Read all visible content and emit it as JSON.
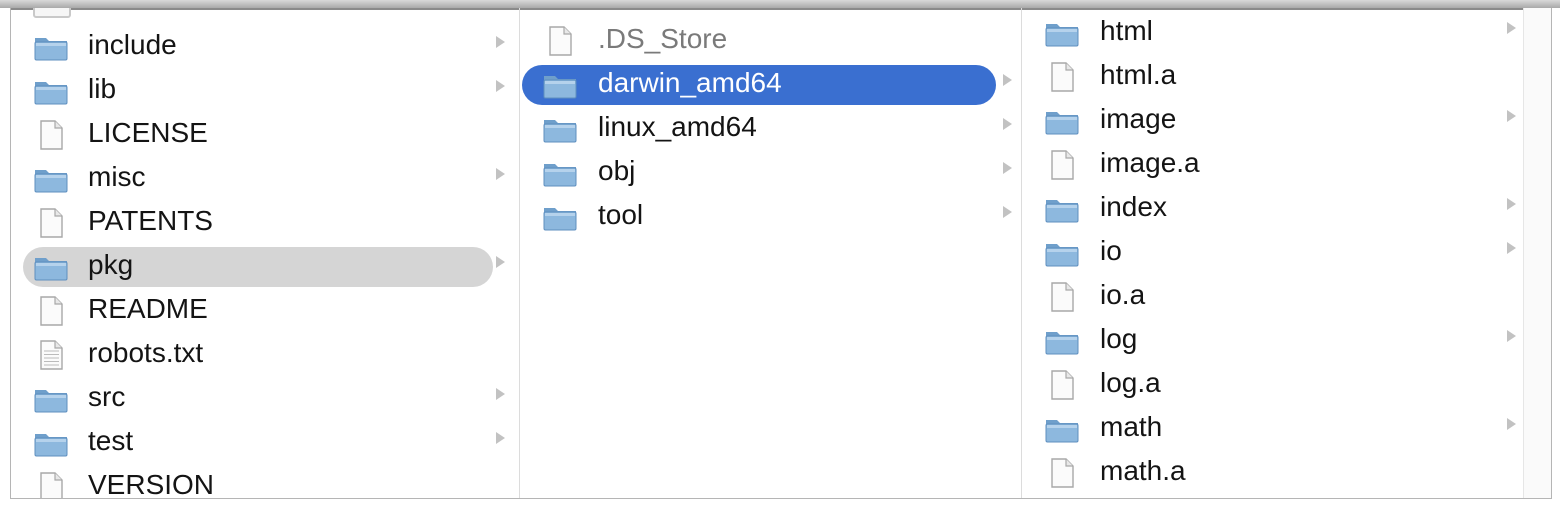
{
  "colors": {
    "selection_active": "#3a6fd0",
    "selection_inactive": "#d5d5d5",
    "folder": "#8db8de",
    "text": "#141414"
  },
  "columns": [
    {
      "items": [
        {
          "name": "include",
          "kind": "folder",
          "arrow": true
        },
        {
          "name": "lib",
          "kind": "folder",
          "arrow": true
        },
        {
          "name": "LICENSE",
          "kind": "file",
          "arrow": false
        },
        {
          "name": "misc",
          "kind": "folder",
          "arrow": true
        },
        {
          "name": "PATENTS",
          "kind": "file",
          "arrow": false
        },
        {
          "name": "pkg",
          "kind": "folder",
          "arrow": true,
          "selected": "inactive"
        },
        {
          "name": "README",
          "kind": "file",
          "arrow": false
        },
        {
          "name": "robots.txt",
          "kind": "text-file",
          "arrow": false
        },
        {
          "name": "src",
          "kind": "folder",
          "arrow": true
        },
        {
          "name": "test",
          "kind": "folder",
          "arrow": true
        },
        {
          "name": "VERSION",
          "kind": "file",
          "arrow": false
        }
      ]
    },
    {
      "items": [
        {
          "name": ".DS_Store",
          "kind": "file",
          "arrow": false,
          "dim": true
        },
        {
          "name": "darwin_amd64",
          "kind": "folder",
          "arrow": true,
          "selected": "active"
        },
        {
          "name": "linux_amd64",
          "kind": "folder",
          "arrow": true
        },
        {
          "name": "obj",
          "kind": "folder",
          "arrow": true
        },
        {
          "name": "tool",
          "kind": "folder",
          "arrow": true
        }
      ]
    },
    {
      "items": [
        {
          "name": "html",
          "kind": "folder",
          "arrow": true
        },
        {
          "name": "html.a",
          "kind": "file",
          "arrow": false
        },
        {
          "name": "image",
          "kind": "folder",
          "arrow": true
        },
        {
          "name": "image.a",
          "kind": "file",
          "arrow": false
        },
        {
          "name": "index",
          "kind": "folder",
          "arrow": true
        },
        {
          "name": "io",
          "kind": "folder",
          "arrow": true
        },
        {
          "name": "io.a",
          "kind": "file",
          "arrow": false
        },
        {
          "name": "log",
          "kind": "folder",
          "arrow": true
        },
        {
          "name": "log.a",
          "kind": "file",
          "arrow": false
        },
        {
          "name": "math",
          "kind": "folder",
          "arrow": true
        },
        {
          "name": "math.a",
          "kind": "file",
          "arrow": false
        }
      ]
    }
  ]
}
